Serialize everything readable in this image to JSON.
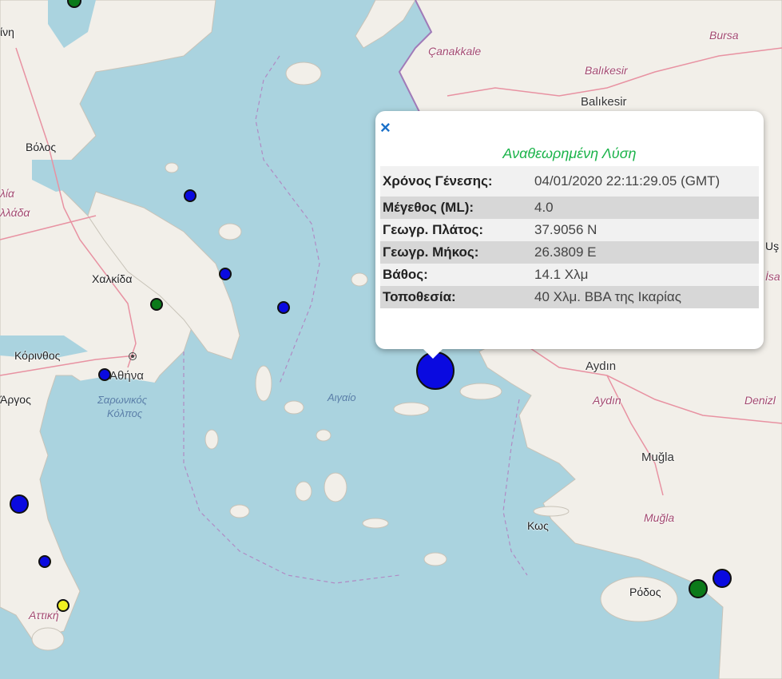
{
  "popup": {
    "close_symbol": "×",
    "title": "Αναθεωρημένη Λύση",
    "rows": [
      {
        "label": "Χρόνος Γένεσης:",
        "value": "04/01/2020 22:11:29.05 (GMT)"
      },
      {
        "label": "Μέγεθος (ML):",
        "value": "4.0"
      },
      {
        "label": "Γεωγρ. Πλάτος:",
        "value": "37.9056 N"
      },
      {
        "label": "Γεωγρ. Μήκος:",
        "value": "26.3809 E"
      },
      {
        "label": "Βάθος:",
        "value": "14.1 Χλμ"
      },
      {
        "label": "Τοποθεσία:",
        "value": "40 Χλμ. ΒΒΑ της Ικαρίας"
      }
    ]
  },
  "labels": {
    "bursa": "Bursa",
    "canakkale": "Çanakkale",
    "balikesir_prov": "Balıkesir",
    "balikesir": "Balıkesir",
    "volos": "Βόλος",
    "chalkida": "Χαλκίδα",
    "korinthos": "Κόρινθος",
    "athina": "Αθήνα",
    "argos": "Άργος",
    "saronikos": "Σαρωνικός",
    "kolpos": "Κόλπος",
    "aigaio": "Αιγαίο",
    "aydin": "Aydın",
    "aydin_prov": "Aydın",
    "denizli": "Denizl",
    "mugla": "Muğla",
    "mugla_prov": "Muğla",
    "kos": "Κως",
    "rodos": "Ρόδος",
    "attiki": "Αττική",
    "ellada1": "λία",
    "ellada2": "λλάδα",
    "pini": "ίνη",
    "us": "Uş",
    "isa": "İsa"
  },
  "colors": {
    "sea": "#aad3df",
    "land": "#f2efe9",
    "marker_blue": "#0a0ae0",
    "marker_green": "#0b7a1a",
    "marker_yellow": "#f0f020",
    "popup_title": "#1bb34a"
  }
}
